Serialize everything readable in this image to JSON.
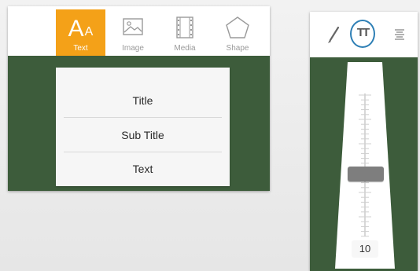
{
  "insert_toolbar": {
    "tools": [
      {
        "label": "Text",
        "icon": "text-aa-icon",
        "selected": true
      },
      {
        "label": "Image",
        "icon": "image-icon",
        "selected": false
      },
      {
        "label": "Media",
        "icon": "film-strip-icon",
        "selected": false
      },
      {
        "label": "Shape",
        "icon": "pentagon-icon",
        "selected": false
      }
    ],
    "text_icon_glyphs": {
      "big": "A",
      "small": "A"
    }
  },
  "text_menu": {
    "items": [
      "Title",
      "Sub Title",
      "Text"
    ]
  },
  "format_toolbar": {
    "buttons": [
      {
        "icon": "brush-icon",
        "selected": false
      },
      {
        "icon": "text-size-icon",
        "selected": true,
        "glyph": "TT"
      },
      {
        "icon": "align-icon",
        "selected": false
      }
    ]
  },
  "font_size_slider": {
    "value": "10"
  },
  "colors": {
    "panel_green": "#3d5c3b",
    "selected_orange": "#f4a118",
    "highlight_ring": "#2e7fb5"
  }
}
